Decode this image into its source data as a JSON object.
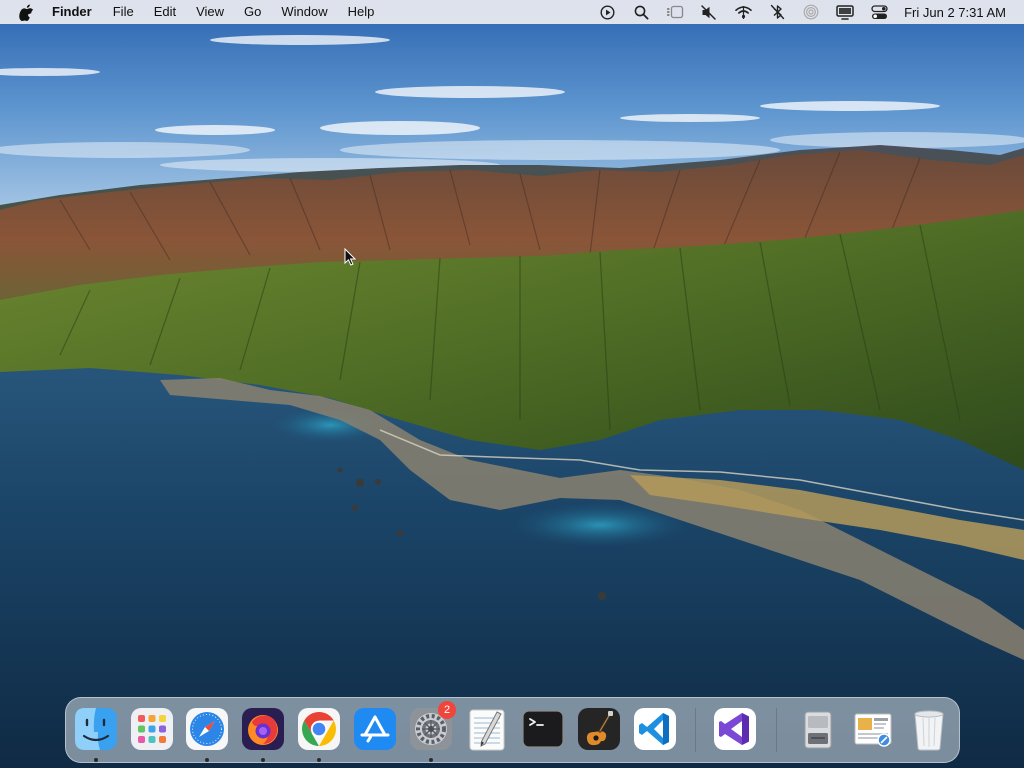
{
  "menubar": {
    "app_name": "Finder",
    "items": [
      "File",
      "Edit",
      "View",
      "Go",
      "Window",
      "Help"
    ],
    "status_icons": [
      "play-circle-icon",
      "search-icon",
      "stage-manager-icon",
      "sound-muted-icon",
      "wifi-icon",
      "bluetooth-off-icon",
      "airdrop-icon",
      "display-icon",
      "control-center-icon"
    ],
    "clock": "Fri Jun 2  7:31 AM"
  },
  "dock": {
    "apps": [
      {
        "name": "finder",
        "running": true
      },
      {
        "name": "launchpad",
        "running": false
      },
      {
        "name": "safari",
        "running": true
      },
      {
        "name": "firefox",
        "running": true
      },
      {
        "name": "chrome",
        "running": true
      },
      {
        "name": "app-store",
        "running": false
      },
      {
        "name": "system-preferences",
        "running": true,
        "badge": "2"
      },
      {
        "name": "textedit",
        "running": false
      },
      {
        "name": "terminal",
        "running": false
      },
      {
        "name": "garageband",
        "running": false
      },
      {
        "name": "vscode",
        "running": false
      },
      {
        "name": "visual-studio",
        "running": false
      },
      {
        "name": "disk-utility",
        "running": false
      },
      {
        "name": "preview",
        "running": false
      },
      {
        "name": "trash",
        "running": false
      }
    ]
  },
  "colors": {
    "menubar_bg": "#ececf0",
    "badge": "#f0453a",
    "sky_top": "#2f6fb8",
    "ocean": "#163b5c"
  }
}
